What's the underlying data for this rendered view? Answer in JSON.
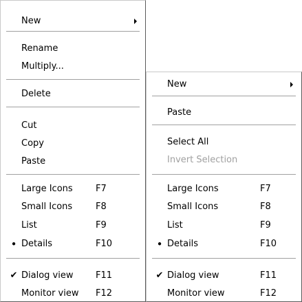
{
  "left_menu": {
    "new": "New",
    "rename": "Rename",
    "multiply": "Multiply...",
    "delete": "Delete",
    "cut": "Cut",
    "copy": "Copy",
    "paste": "Paste",
    "large_icons": "Large Icons",
    "large_icons_key": "F7",
    "small_icons": "Small Icons",
    "small_icons_key": "F8",
    "list": "List",
    "list_key": "F9",
    "details": "Details",
    "details_key": "F10",
    "dialog_view": "Dialog view",
    "dialog_view_key": "F11",
    "monitor_view": "Monitor view",
    "monitor_view_key": "F12"
  },
  "right_menu": {
    "new": "New",
    "paste": "Paste",
    "select_all": "Select All",
    "invert_selection": "Invert Selection",
    "large_icons": "Large Icons",
    "large_icons_key": "F7",
    "small_icons": "Small Icons",
    "small_icons_key": "F8",
    "list": "List",
    "list_key": "F9",
    "details": "Details",
    "details_key": "F10",
    "dialog_view": "Dialog view",
    "dialog_view_key": "F11",
    "monitor_view": "Monitor view",
    "monitor_view_key": "F12"
  },
  "marks": {
    "details_bullet": "•",
    "dialog_view_check": "✔"
  },
  "disabled_color": "#a0a0a0"
}
